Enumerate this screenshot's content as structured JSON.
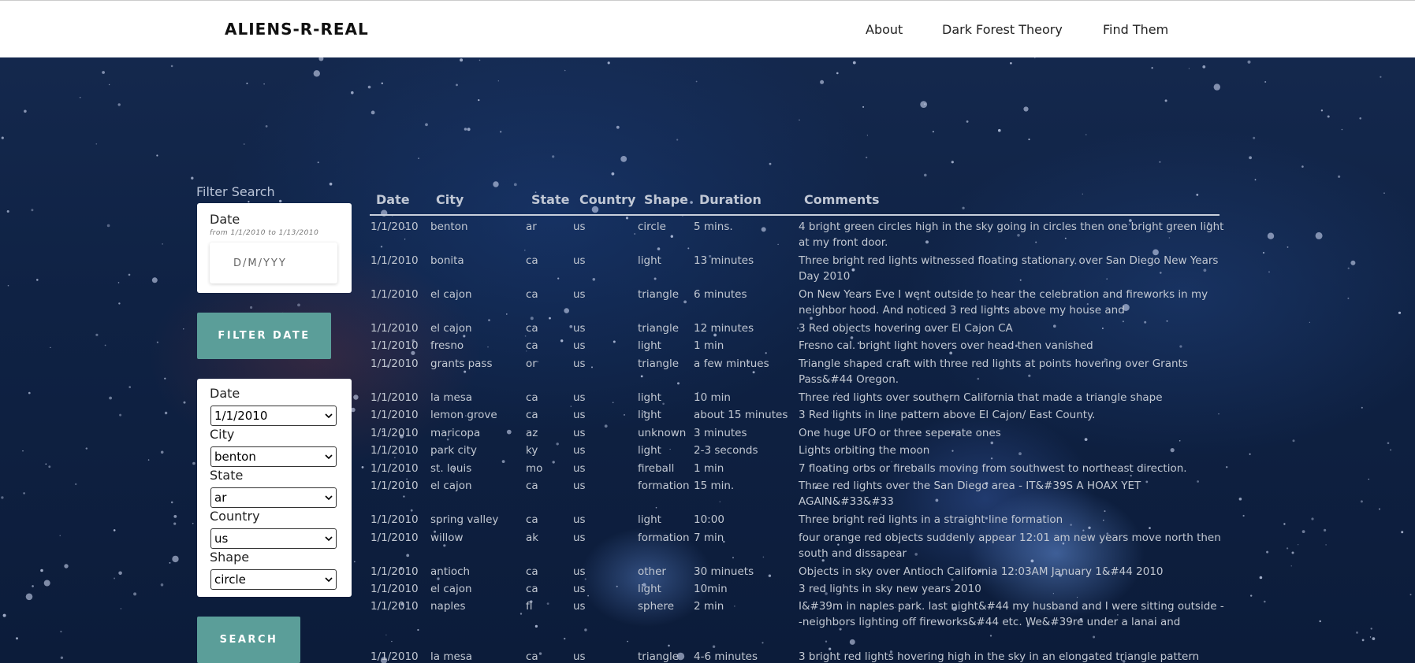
{
  "nav": {
    "brand": "ALIENS-R-REAL",
    "links": [
      "About",
      "Dark Forest Theory",
      "Find Them"
    ]
  },
  "filter": {
    "title": "Filter Search",
    "date_label": "Date",
    "date_range": "from 1/1/2010 to 1/13/2010",
    "date_placeholder": "D/M/YYY",
    "filter_button": "FILTER DATE",
    "search_button": "SEARCH",
    "selects": [
      {
        "label": "Date",
        "value": "1/1/2010"
      },
      {
        "label": "City",
        "value": "benton"
      },
      {
        "label": "State",
        "value": "ar"
      },
      {
        "label": "Country",
        "value": "us"
      },
      {
        "label": "Shape",
        "value": "circle"
      }
    ]
  },
  "table": {
    "headers": [
      "Date",
      "City",
      "State",
      "Country",
      "Shape",
      "Duration",
      "Comments"
    ],
    "rows": [
      [
        "1/1/2010",
        "benton",
        "ar",
        "us",
        "circle",
        "5 mins.",
        "4 bright green circles high in the sky going in circles then one bright green light at my front door."
      ],
      [
        "1/1/2010",
        "bonita",
        "ca",
        "us",
        "light",
        "13 minutes",
        "Three bright red lights witnessed floating stationary over San Diego New Years Day 2010"
      ],
      [
        "1/1/2010",
        "el cajon",
        "ca",
        "us",
        "triangle",
        "6 minutes",
        "On New Years Eve I went outside to hear the celebration and fireworks in my neighbor hood. And noticed 3 red lights above my house and"
      ],
      [
        "1/1/2010",
        "el cajon",
        "ca",
        "us",
        "triangle",
        "12 minutes",
        "3 Red objects hovering over El Cajon CA"
      ],
      [
        "1/1/2010",
        "fresno",
        "ca",
        "us",
        "light",
        "1 min",
        "Fresno cal. bright light hovers over head then vanished"
      ],
      [
        "1/1/2010",
        "grants pass",
        "or",
        "us",
        "triangle",
        "a few mintues",
        "Triangle shaped craft with three red lights at points hovering over Grants Pass&#44 Oregon."
      ],
      [
        "1/1/2010",
        "la mesa",
        "ca",
        "us",
        "light",
        "10 min",
        "Three red lights over southern California that made a triangle shape"
      ],
      [
        "1/1/2010",
        "lemon grove",
        "ca",
        "us",
        "light",
        "about 15 minutes",
        "3 Red lights in line pattern above El Cajon/ East County."
      ],
      [
        "1/1/2010",
        "maricopa",
        "az",
        "us",
        "unknown",
        "3 minutes",
        "One huge UFO or three seperate ones"
      ],
      [
        "1/1/2010",
        "park city",
        "ky",
        "us",
        "light",
        "2-3 seconds",
        "Lights orbiting the moon"
      ],
      [
        "1/1/2010",
        "st. louis",
        "mo",
        "us",
        "fireball",
        "1 min",
        "7 floating orbs or fireballs moving from southwest to northeast direction."
      ],
      [
        "1/1/2010",
        "el cajon",
        "ca",
        "us",
        "formation",
        "15 min.",
        "Three red lights over the San Diego area - IT&#39S A HOAX YET AGAIN&#33&#33"
      ],
      [
        "1/1/2010",
        "spring valley",
        "ca",
        "us",
        "light",
        "10:00",
        "Three bright red lights in a straight line formation"
      ],
      [
        "1/1/2010",
        "willow",
        "ak",
        "us",
        "formation",
        "7 min",
        "four orange red objects suddenly appear 12:01 am new years move north then south and dissapear"
      ],
      [
        "1/1/2010",
        "antioch",
        "ca",
        "us",
        "other",
        "30 minuets",
        "Objects in sky over Antioch California 12:03AM January 1&#44 2010"
      ],
      [
        "1/1/2010",
        "el cajon",
        "ca",
        "us",
        "light",
        "10min",
        "3 red lights in sky new years 2010"
      ],
      [
        "1/1/2010",
        "naples",
        "fl",
        "us",
        "sphere",
        "2 min",
        "I&#39m in naples park. last night&#44 my husband and I were sitting outside --neighbors lighting off fireworks&#44 etc. We&#39re under a lanai and"
      ],
      [
        "1/1/2010",
        "la mesa",
        "ca",
        "us",
        "triangle",
        "4-6 minutes",
        "3 bright red lights hovering high in the sky in an elongated triangle pattern"
      ]
    ]
  }
}
